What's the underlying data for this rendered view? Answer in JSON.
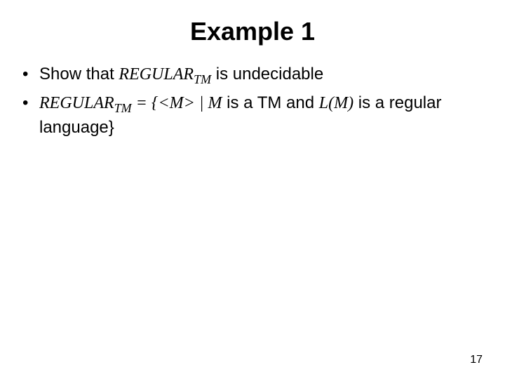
{
  "title": "Example 1",
  "bullets": [
    {
      "pre": "Show that ",
      "term": "REGULAR",
      "sub": "TM",
      "post": " is undecidable"
    },
    {
      "term": "REGULAR",
      "sub": "TM",
      "eq": " = {<",
      "mvar1": "M",
      "mid1": "> | ",
      "mvar2": "M",
      "mid2": " is a TM and ",
      "lm": "L(M)",
      "post": " is a regular language}"
    }
  ],
  "page": "17"
}
